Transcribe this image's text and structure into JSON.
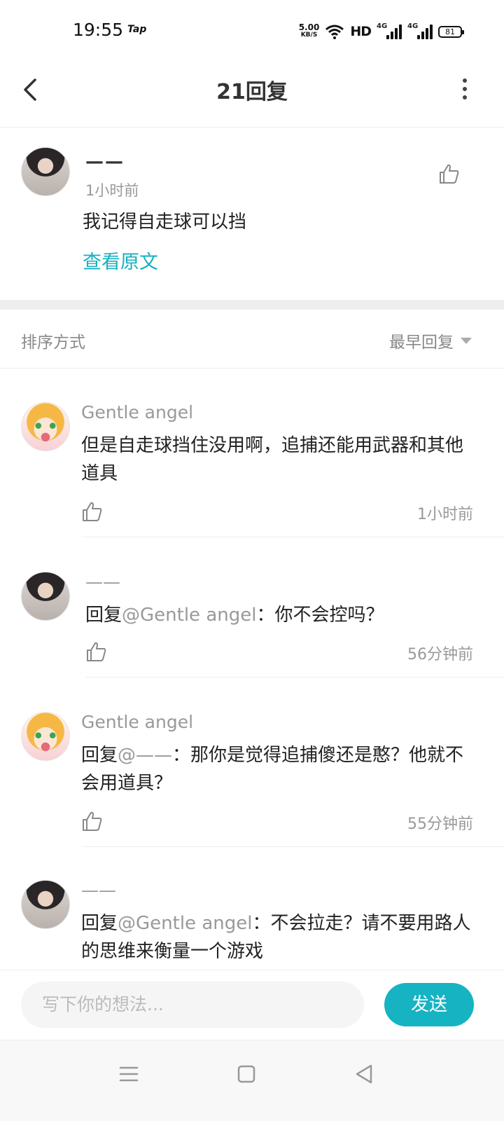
{
  "status_bar": {
    "time": "19:55",
    "app_badge": "Tap",
    "speed_value": "5.00",
    "speed_unit": "KB/S",
    "hd_label": "HD",
    "network_1": "4G",
    "network_2": "4G",
    "battery": "81"
  },
  "header": {
    "title": "21回复"
  },
  "original_comment": {
    "author": "——",
    "time": "1小时前",
    "text": "我记得自走球可以挡",
    "view_original_link": "查看原文"
  },
  "sort": {
    "label": "排序方式",
    "selected": "最早回复"
  },
  "replies": [
    {
      "author": "Gentle angel",
      "reply_prefix": "",
      "mention": "",
      "text": "但是自走球挡住没用啊，追捕还能用武器和其他道具",
      "time": "1小时前"
    },
    {
      "author": "——",
      "reply_prefix": "回复",
      "mention": "@Gentle angel",
      "text": "：你不会控吗？",
      "time": "56分钟前"
    },
    {
      "author": "Gentle angel",
      "reply_prefix": "回复",
      "mention": "@——",
      "text": "：那你是觉得追捕傻还是憨？他就不会用道具？",
      "time": "55分钟前"
    },
    {
      "author": "——",
      "reply_prefix": "回复",
      "mention": "@Gentle angel",
      "text": "：不会拉走？请不要用路人的思维来衡量一个游戏",
      "time": ""
    }
  ],
  "composer": {
    "placeholder": "写下你的想法...",
    "send_label": "发送"
  },
  "colors": {
    "accent": "#16b3c3",
    "link": "#15b0c0",
    "muted_text": "#999999"
  },
  "icons": {
    "back": "chevron-left-icon",
    "more": "more-vertical-icon",
    "like": "thumbs-up-icon",
    "nav_menu": "menu-icon",
    "nav_home": "square-icon",
    "nav_back": "triangle-back-icon"
  }
}
